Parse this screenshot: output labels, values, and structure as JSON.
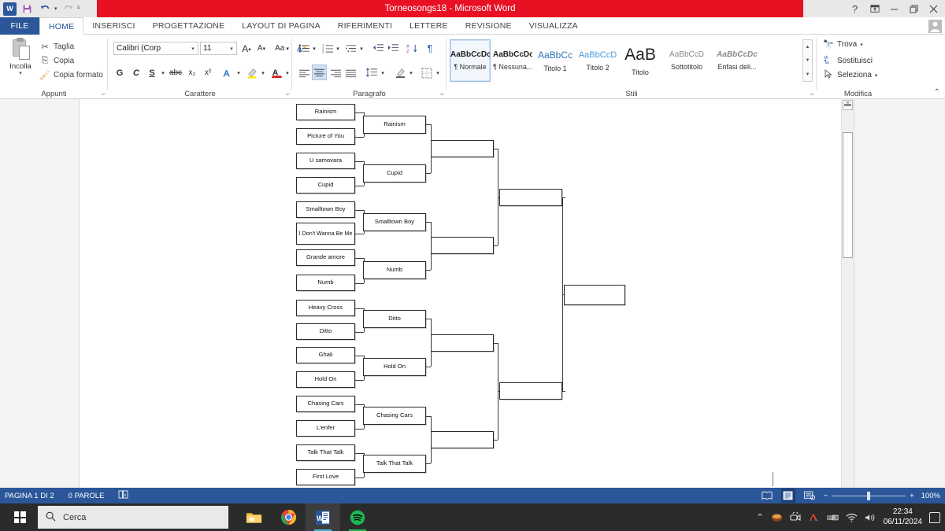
{
  "window": {
    "title": "Torneosongs18 -  Microsoft Word",
    "quick_access": {
      "word_icon": "word-logo",
      "save_icon": "save-icon",
      "undo_icon": "undo-icon",
      "redo_icon": "redo-icon",
      "customize_icon": "chevron-down-icon"
    },
    "buttons": {
      "help": "?",
      "ribbon_display": "ribbon-display-icon",
      "minimize": "minimize-icon",
      "restore": "restore-icon",
      "close": "close-icon"
    },
    "account_icon": "account-icon"
  },
  "tabs": {
    "file": "FILE",
    "items": [
      "HOME",
      "INSERISCI",
      "PROGETTAZIONE",
      "LAYOUT DI PAGINA",
      "RIFERIMENTI",
      "LETTERE",
      "REVISIONE",
      "VISUALIZZA"
    ],
    "active": "HOME"
  },
  "ribbon": {
    "groups": [
      "Appunti",
      "Carattere",
      "Paragrafo",
      "Stili",
      "Modifica"
    ],
    "clipboard": {
      "paste": "Incolla",
      "cut": "Taglia",
      "copy": "Copia",
      "format_painter": "Copia formato",
      "group": "Appunti"
    },
    "font": {
      "family": "Calibri (Corp",
      "size": "11",
      "bold": "G",
      "italic": "C",
      "underline": "S",
      "strikethrough": "abc",
      "subscript": "x₂",
      "superscript": "x²",
      "grow_font": "A",
      "shrink_font": "A",
      "change_case": "Aa",
      "clear_formatting": "clear-formatting-icon",
      "text_effects": "A",
      "highlight": "highlight-icon",
      "font_color": "A",
      "group": "Carattere"
    },
    "paragraph": {
      "group": "Paragrafo",
      "bullets": "bullets-icon",
      "numbering": "numbering-icon",
      "multilevel": "multilevel-list-icon",
      "decrease_indent": "decrease-indent-icon",
      "increase_indent": "increase-indent-icon",
      "sort": "sort-icon",
      "show_marks": "¶",
      "align_left": "align-left-icon",
      "align_center": "align-center-icon",
      "align_right": "align-right-icon",
      "justify": "justify-icon",
      "line_spacing": "line-spacing-icon",
      "shading": "shading-icon",
      "borders": "borders-icon"
    },
    "styles": {
      "group": "Stili",
      "items": [
        {
          "preview": "AaBbCcDc",
          "name": "¶ Normale",
          "selected": true
        },
        {
          "preview": "AaBbCcDc",
          "name": "¶ Nessuna...",
          "selected": false
        },
        {
          "preview": "AaBbCc",
          "name": "Titolo 1",
          "selected": false
        },
        {
          "preview": "AaBbCcD",
          "name": "Titolo 2",
          "selected": false
        },
        {
          "preview": "AaB",
          "name": "Titolo",
          "selected": false
        },
        {
          "preview": "AaBbCcD",
          "name": "Sottotitolo",
          "selected": false
        },
        {
          "preview": "AaBbCcDc",
          "name": "Enfasi deli...",
          "selected": false
        }
      ]
    },
    "editing": {
      "group": "Modifica",
      "find": "Trova",
      "replace": "Sostituisci",
      "select": "Seleziona",
      "collapse_ribbon": "collapse-ribbon-icon"
    }
  },
  "bracket": {
    "round1": [
      "Rainism",
      "Picture of You",
      "U samovara",
      "Cupid",
      "Smalltown Boy",
      "I Don't Wanna Be Me",
      "Grande amore",
      "Numb",
      "Heavy Cross",
      "Ditto",
      "Ghali",
      "Hold On",
      "Chasing Cars",
      "L'enfer",
      "Talk That Talk",
      "First Love"
    ],
    "round2": [
      "Rainism",
      "Cupid",
      "Smalltown Boy",
      "Numb",
      "Ditto",
      "Hold On",
      "Chasing Cars",
      "Talk That Talk"
    ],
    "round3": [
      "",
      "",
      "",
      ""
    ],
    "round4": [
      "",
      ""
    ],
    "final": [
      ""
    ]
  },
  "statusbar": {
    "page": "PAGINA 1 DI 2",
    "words": "0 PAROLE",
    "proofing_icon": "proofing-icon",
    "views": {
      "read_mode": "read-mode-icon",
      "print_layout": "print-layout-icon",
      "web_layout": "web-layout-icon"
    },
    "zoom_out": "−",
    "zoom_in": "+",
    "zoom_level": "100%"
  },
  "taskbar": {
    "start_icon": "windows-start-icon",
    "search_placeholder": "Cerca",
    "search_icon": "search-icon",
    "apps": [
      {
        "name": "file-explorer",
        "label": "File Explorer"
      },
      {
        "name": "google-chrome",
        "label": "Google Chrome"
      },
      {
        "name": "microsoft-word",
        "label": "Microsoft Word"
      },
      {
        "name": "spotify",
        "label": "Spotify"
      }
    ],
    "tray": {
      "show_hidden": "chevron-up-icon",
      "icons": [
        "ibm-icon",
        "camera-icon",
        "adobe-icon",
        "keyboard-icon",
        "wifi-icon",
        "volume-icon"
      ],
      "time": "22:34",
      "date": "06/11/2024",
      "notifications": "notifications-icon"
    }
  },
  "colors": {
    "word_red": "#e81123",
    "word_blue": "#2b579a",
    "taskbar": "#2b2b2b"
  }
}
